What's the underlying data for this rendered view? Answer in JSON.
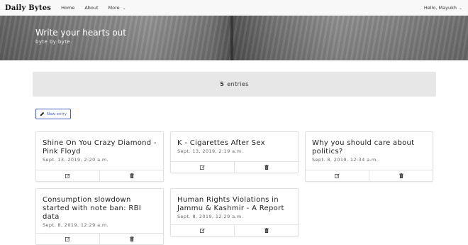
{
  "navbar": {
    "brand": "Daily Bytes",
    "links": [
      {
        "label": "Home"
      },
      {
        "label": "About"
      },
      {
        "label": "More"
      }
    ],
    "user_greeting": "Hello, Mayukh"
  },
  "hero": {
    "title": "Write your hearts out",
    "subtitle": "byte by byte."
  },
  "entries": {
    "count": "5",
    "label": "entries"
  },
  "new_entry_label": "New entry",
  "cards": [
    {
      "title": "Shine On You Crazy Diamond - Pink Floyd",
      "date": "Sept. 13, 2019, 2:20 a.m."
    },
    {
      "title": "K - Cigarettes After Sex",
      "date": "Sept. 13, 2019, 2:19 a.m."
    },
    {
      "title": "Why you should care about politics?",
      "date": "Sept. 8, 2019, 12:34 a.m."
    },
    {
      "title": "Consumption slowdown started with note ban: RBI data",
      "date": "Sept. 8, 2019, 12:29 a.m."
    },
    {
      "title": "Human Rights Violations in Jammu & Kashmir - A Report",
      "date": "Sept. 8, 2019, 12:29 a.m."
    }
  ],
  "icons": {
    "edit": "edit-icon",
    "delete": "trash-icon",
    "new": "pencil-icon",
    "dropdown": "chevron-down-icon"
  },
  "colors": {
    "accent": "#4b63c9",
    "navbar_bg": "#f8f8f8",
    "entries_bar_bg": "#e7e7e7"
  }
}
